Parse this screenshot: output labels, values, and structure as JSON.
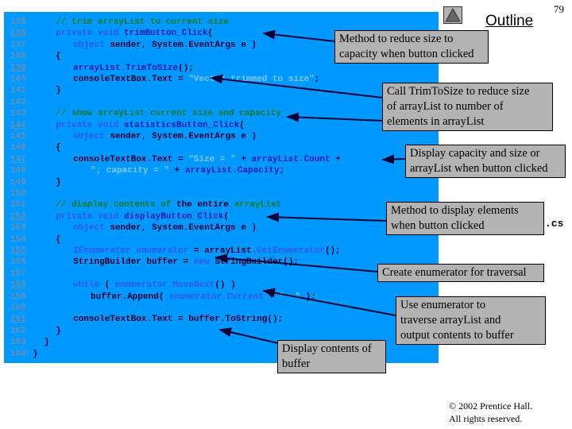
{
  "header": {
    "outline_label": "Outline",
    "page_number": "79",
    "file_suffix": ".cs"
  },
  "code": [
    {
      "n": "135",
      "u": false,
      "ind": 4,
      "seg": [
        [
          "cm",
          "// trim arrayList to current size"
        ]
      ]
    },
    {
      "n": "136",
      "u": true,
      "ind": 4,
      "seg": [
        [
          "kw",
          "private void "
        ],
        [
          "id",
          "trimButton_Click"
        ],
        [
          "pl",
          "("
        ]
      ]
    },
    {
      "n": "137",
      "u": false,
      "ind": 7,
      "seg": [
        [
          "kw",
          "object "
        ],
        [
          "pl",
          "sender, System.EventArgs e )"
        ]
      ]
    },
    {
      "n": "138",
      "u": false,
      "ind": 4,
      "seg": [
        [
          "pl",
          "{"
        ]
      ]
    },
    {
      "n": "139",
      "u": true,
      "ind": 7,
      "seg": [
        [
          "id",
          "arrayList.TrimToSize"
        ],
        [
          "pl",
          "();"
        ]
      ]
    },
    {
      "n": "140",
      "u": false,
      "ind": 7,
      "seg": [
        [
          "pl",
          "consoleTextBox.Text = "
        ],
        [
          "st",
          "\"Vector trimmed to size\""
        ],
        [
          "pl",
          ";"
        ]
      ]
    },
    {
      "n": "141",
      "u": false,
      "ind": 4,
      "seg": [
        [
          "pl",
          "}"
        ]
      ]
    },
    {
      "n": "142",
      "u": false,
      "ind": 0,
      "seg": []
    },
    {
      "n": "143",
      "u": false,
      "ind": 4,
      "seg": [
        [
          "cm",
          "// show arrayList current size and capacity"
        ]
      ]
    },
    {
      "n": "144",
      "u": true,
      "ind": 4,
      "seg": [
        [
          "kw",
          "private void "
        ],
        [
          "id",
          "statisticsButton_Click"
        ],
        [
          "pl",
          "("
        ]
      ]
    },
    {
      "n": "145",
      "u": false,
      "ind": 7,
      "seg": [
        [
          "kw",
          "object "
        ],
        [
          "pl",
          "sender, System.EventArgs e )"
        ]
      ]
    },
    {
      "n": "146",
      "u": false,
      "ind": 4,
      "seg": [
        [
          "pl",
          "{"
        ]
      ]
    },
    {
      "n": "147",
      "u": true,
      "ind": 7,
      "seg": [
        [
          "pl",
          "consoleTextBox.Text = "
        ],
        [
          "st",
          "\"Size = \""
        ],
        [
          "pl",
          " + "
        ],
        [
          "id",
          "arrayList.Count"
        ],
        [
          "pl",
          " +"
        ]
      ]
    },
    {
      "n": "148",
      "u": false,
      "ind": 10,
      "seg": [
        [
          "st",
          "\"; capacity = \""
        ],
        [
          "pl",
          " + "
        ],
        [
          "id",
          "arrayList.Capacity"
        ],
        [
          "pl",
          ";"
        ]
      ]
    },
    {
      "n": "149",
      "u": false,
      "ind": 4,
      "seg": [
        [
          "pl",
          "}"
        ]
      ]
    },
    {
      "n": "150",
      "u": false,
      "ind": 0,
      "seg": []
    },
    {
      "n": "151",
      "u": false,
      "ind": 4,
      "seg": [
        [
          "cm",
          "// display contents of "
        ],
        [
          "pl",
          "the entire "
        ],
        [
          "cm",
          "arrayList"
        ]
      ]
    },
    {
      "n": "152",
      "u": true,
      "ind": 4,
      "seg": [
        [
          "kw",
          "private void "
        ],
        [
          "id",
          "displayButton_Click"
        ],
        [
          "pl",
          "("
        ]
      ]
    },
    {
      "n": "153",
      "u": false,
      "ind": 7,
      "seg": [
        [
          "kw",
          "object "
        ],
        [
          "pl",
          "sender, System.EventArgs e )"
        ]
      ]
    },
    {
      "n": "154",
      "u": false,
      "ind": 4,
      "seg": [
        [
          "pl",
          "{"
        ]
      ]
    },
    {
      "n": "155",
      "u": true,
      "ind": 7,
      "seg": [
        [
          "kw",
          "IEnumerator enumerator"
        ],
        [
          "pl",
          " = arrayList."
        ],
        [
          "kw",
          "GetEnumerator"
        ],
        [
          "pl",
          "();"
        ]
      ]
    },
    {
      "n": "156",
      "u": false,
      "ind": 7,
      "seg": [
        [
          "pl",
          "StringBuilder buffer = "
        ],
        [
          "kw",
          "new "
        ],
        [
          "pl",
          "StringBuilder();"
        ]
      ]
    },
    {
      "n": "157",
      "u": false,
      "ind": 0,
      "seg": []
    },
    {
      "n": "158",
      "u": true,
      "ind": 7,
      "seg": [
        [
          "kw",
          "while "
        ],
        [
          "pl",
          "( "
        ],
        [
          "kw",
          "enumerator.MoveNext"
        ],
        [
          "pl",
          "() )"
        ]
      ]
    },
    {
      "n": "159",
      "u": false,
      "ind": 10,
      "seg": [
        [
          "pl",
          "buffer.Append( "
        ],
        [
          "kw",
          "enumerator.Current"
        ],
        [
          "pl",
          " + "
        ],
        [
          "st",
          "\"  \""
        ],
        [
          "pl",
          " );"
        ]
      ]
    },
    {
      "n": "160",
      "u": false,
      "ind": 0,
      "seg": []
    },
    {
      "n": "161",
      "u": true,
      "ind": 7,
      "seg": [
        [
          "pl",
          "consoleTextBox.Text = buffer.ToString();"
        ]
      ]
    },
    {
      "n": "162",
      "u": false,
      "ind": 4,
      "seg": [
        [
          "pl",
          "}"
        ]
      ]
    },
    {
      "n": "163",
      "u": false,
      "ind": 2,
      "seg": [
        [
          "pl",
          "}"
        ]
      ]
    },
    {
      "n": "164",
      "u": false,
      "ind": 0,
      "seg": [
        [
          "pl",
          "}"
        ]
      ]
    }
  ],
  "callouts": [
    "Method to reduce size to\ncapacity when button clicked",
    "Call TrimToSize to reduce size\nof arrayList to number of\nelements in arrayList",
    "Display capacity and size or\narrayList when button clicked",
    "Method to display elements\nwhen button clicked",
    "Create enumerator for traversal",
    "Use enumerator to\ntraverse arrayList and\noutput contents to buffer",
    "Display contents of\nbuffer"
  ],
  "footer": {
    "copyright": "© 2002 Prentice Hall.\nAll rights reserved."
  }
}
